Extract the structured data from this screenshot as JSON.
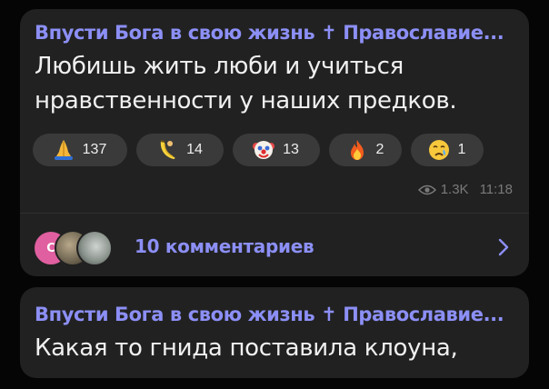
{
  "post": {
    "channel_name": "Впусти Бога в свою жизнь ✝ Православие...",
    "text_lines": [
      "Любишь жить люби и учиться",
      "нравственности у наших предков."
    ],
    "reactions": [
      {
        "icon": "praying-hands-icon",
        "count": "137"
      },
      {
        "icon": "banana-icon",
        "count": "14"
      },
      {
        "icon": "clown-face-icon",
        "count": "13"
      },
      {
        "icon": "fire-icon",
        "count": "2"
      },
      {
        "icon": "crying-face-icon",
        "count": "1"
      }
    ],
    "views": "1.3K",
    "time": "11:18",
    "comments": {
      "avatar_letter": "C",
      "label": "10 комментариев"
    }
  },
  "reply": {
    "channel_name": "Впусти Бога в свою жизнь ✝ Православие...",
    "text": "Какая то гнида поставила клоуна,"
  },
  "colors": {
    "bubble": "#212121",
    "accent": "#8c8ff5",
    "avatar_letter_bg": "#e05fa0"
  }
}
